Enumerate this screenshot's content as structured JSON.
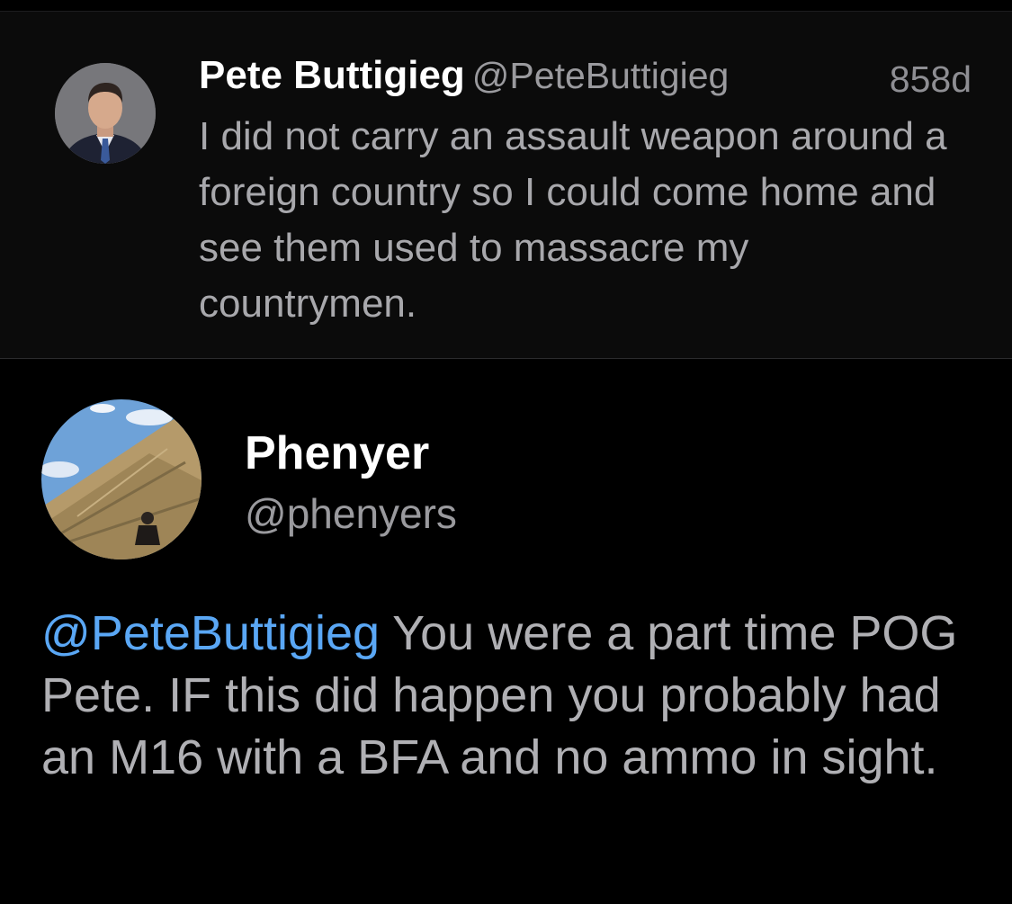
{
  "quoted_tweet": {
    "author_name": "Pete Buttigieg",
    "author_handle": "@PeteButtigieg",
    "age": "858d",
    "text": "I did not carry an assault weapon around a foreign country so I could come home and see them used to massacre my countrymen."
  },
  "reply": {
    "author_name": "Phenyer",
    "author_handle": "@phenyers",
    "mention": "@PeteButtigieg",
    "text": " You were a part time POG Pete. IF this did happen you probably had an M16 with a BFA and no ammo in sight."
  },
  "colors": {
    "background": "#000000",
    "quoted_background": "#0b0b0b",
    "mention": "#5aa7f5",
    "secondary_text": "#9a9a9e"
  },
  "icons": {
    "quoted_avatar": "portrait-avatar",
    "reply_avatar": "pyramid-photo-avatar"
  }
}
